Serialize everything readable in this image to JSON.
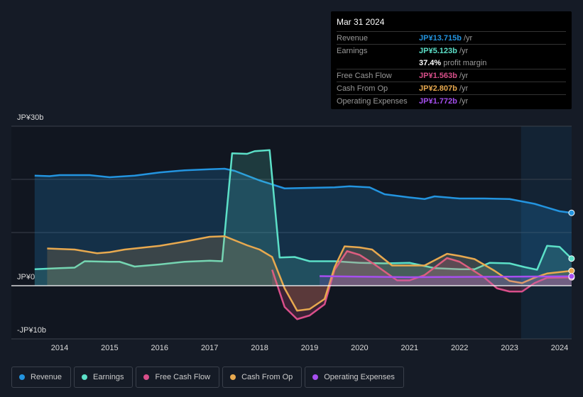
{
  "tooltip": {
    "date": "Mar 31 2024",
    "rows": [
      {
        "label": "Revenue",
        "value": "JP¥13.715b",
        "unit": "/yr",
        "color": "#2394df"
      },
      {
        "label": "Earnings",
        "value": "JP¥5.123b",
        "unit": "/yr",
        "color": "#5ce0c8"
      },
      {
        "label": "",
        "value": "37.4%",
        "unit": "profit margin",
        "color": "#ffffff"
      },
      {
        "label": "Free Cash Flow",
        "value": "JP¥1.563b",
        "unit": "/yr",
        "color": "#d94f8a"
      },
      {
        "label": "Cash From Op",
        "value": "JP¥2.807b",
        "unit": "/yr",
        "color": "#e8a94f"
      },
      {
        "label": "Operating Expenses",
        "value": "JP¥1.772b",
        "unit": "/yr",
        "color": "#a64ff0"
      }
    ]
  },
  "chart_data": {
    "type": "area",
    "y_ticks": [
      "JP¥30b",
      "JP¥0",
      "-JP¥10b"
    ],
    "ylim": [
      -10,
      30
    ],
    "xlim": [
      2013.49,
      2024.24
    ],
    "x_ticks": [
      "2014",
      "2015",
      "2016",
      "2017",
      "2018",
      "2019",
      "2020",
      "2021",
      "2022",
      "2023",
      "2024"
    ],
    "grid": true,
    "legend_placement": "bottom",
    "highlight_from": 2023.23,
    "series": [
      {
        "name": "Revenue",
        "color": "#2394df",
        "points": [
          [
            2013.5,
            20.7
          ],
          [
            2013.8,
            20.6
          ],
          [
            2014.0,
            20.8
          ],
          [
            2014.6,
            20.8
          ],
          [
            2015.0,
            20.4
          ],
          [
            2015.5,
            20.7
          ],
          [
            2016,
            21.3
          ],
          [
            2016.5,
            21.7
          ],
          [
            2017,
            21.9
          ],
          [
            2017.3,
            22.0
          ],
          [
            2017.5,
            21.6
          ],
          [
            2018,
            19.8
          ],
          [
            2018.5,
            18.3
          ],
          [
            2019,
            18.4
          ],
          [
            2019.5,
            18.5
          ],
          [
            2019.8,
            18.7
          ],
          [
            2020.2,
            18.5
          ],
          [
            2020.5,
            17.2
          ],
          [
            2021,
            16.6
          ],
          [
            2021.3,
            16.3
          ],
          [
            2021.5,
            16.8
          ],
          [
            2022,
            16.4
          ],
          [
            2022.5,
            16.4
          ],
          [
            2023,
            16.3
          ],
          [
            2023.5,
            15.4
          ],
          [
            2024,
            14.0
          ],
          [
            2024.24,
            13.7
          ]
        ]
      },
      {
        "name": "Earnings",
        "color": "#5ce0c8",
        "points": [
          [
            2013.5,
            3.1
          ],
          [
            2014,
            3.3
          ],
          [
            2014.3,
            3.4
          ],
          [
            2014.5,
            4.6
          ],
          [
            2015,
            4.5
          ],
          [
            2015.2,
            4.5
          ],
          [
            2015.5,
            3.6
          ],
          [
            2016,
            4.0
          ],
          [
            2016.5,
            4.5
          ],
          [
            2017,
            4.7
          ],
          [
            2017.25,
            4.6
          ],
          [
            2017.45,
            24.9
          ],
          [
            2017.75,
            24.8
          ],
          [
            2017.9,
            25.3
          ],
          [
            2018.2,
            25.5
          ],
          [
            2018.4,
            5.3
          ],
          [
            2018.7,
            5.4
          ],
          [
            2019,
            4.6
          ],
          [
            2019.5,
            4.6
          ],
          [
            2020,
            4.3
          ],
          [
            2020.5,
            4.2
          ],
          [
            2021,
            4.3
          ],
          [
            2021.5,
            3.3
          ],
          [
            2022,
            3.1
          ],
          [
            2022.3,
            3.1
          ],
          [
            2022.6,
            4.3
          ],
          [
            2023,
            4.2
          ],
          [
            2023.3,
            3.5
          ],
          [
            2023.55,
            3.0
          ],
          [
            2023.75,
            7.5
          ],
          [
            2024,
            7.3
          ],
          [
            2024.24,
            5.1
          ]
        ]
      },
      {
        "name": "Free Cash Flow",
        "color": "#d94f8a",
        "points": [
          [
            2018.25,
            3.0
          ],
          [
            2018.5,
            -4
          ],
          [
            2018.75,
            -6.3
          ],
          [
            2019,
            -5.6
          ],
          [
            2019.3,
            -3.5
          ],
          [
            2019.5,
            3
          ],
          [
            2019.75,
            6.5
          ],
          [
            2020,
            5.8
          ],
          [
            2020.3,
            4
          ],
          [
            2020.75,
            1.0
          ],
          [
            2021,
            1.0
          ],
          [
            2021.3,
            2.0
          ],
          [
            2021.75,
            5.2
          ],
          [
            2022,
            4.5
          ],
          [
            2022.5,
            1.5
          ],
          [
            2022.75,
            -0.5
          ],
          [
            2023,
            -1.1
          ],
          [
            2023.25,
            -1.1
          ],
          [
            2023.5,
            0.5
          ],
          [
            2023.75,
            1.5
          ],
          [
            2024.24,
            1.56
          ]
        ]
      },
      {
        "name": "Cash From Op",
        "color": "#e8a94f",
        "points": [
          [
            2013.75,
            7.0
          ],
          [
            2014.3,
            6.8
          ],
          [
            2014.75,
            6.1
          ],
          [
            2015,
            6.3
          ],
          [
            2015.3,
            6.8
          ],
          [
            2016,
            7.5
          ],
          [
            2016.5,
            8.3
          ],
          [
            2017,
            9.2
          ],
          [
            2017.3,
            9.3
          ],
          [
            2017.75,
            7.6
          ],
          [
            2018,
            6.8
          ],
          [
            2018.25,
            5.4
          ],
          [
            2018.5,
            -0.5
          ],
          [
            2018.75,
            -4.7
          ],
          [
            2019,
            -4.4
          ],
          [
            2019.3,
            -2.5
          ],
          [
            2019.5,
            3.5
          ],
          [
            2019.7,
            7.4
          ],
          [
            2020,
            7.2
          ],
          [
            2020.25,
            6.8
          ],
          [
            2020.65,
            3.8
          ],
          [
            2021,
            3.8
          ],
          [
            2021.3,
            3.8
          ],
          [
            2021.75,
            6.0
          ],
          [
            2022,
            5.6
          ],
          [
            2022.3,
            5.0
          ],
          [
            2022.7,
            2.8
          ],
          [
            2023,
            0.9
          ],
          [
            2023.25,
            0.5
          ],
          [
            2023.5,
            1.5
          ],
          [
            2023.75,
            2.3
          ],
          [
            2024.24,
            2.8
          ]
        ]
      },
      {
        "name": "Operating Expenses",
        "color": "#a64ff0",
        "points": [
          [
            2019.2,
            1.8
          ],
          [
            2020,
            1.7
          ],
          [
            2021,
            1.6
          ],
          [
            2022,
            1.65
          ],
          [
            2023,
            1.7
          ],
          [
            2024.24,
            1.77
          ]
        ]
      }
    ]
  }
}
